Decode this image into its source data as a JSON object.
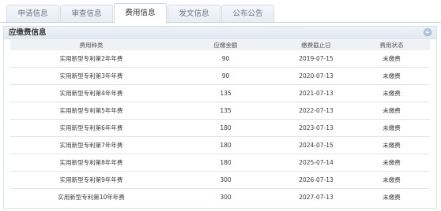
{
  "tabs": [
    {
      "label": "申请信息",
      "active": false
    },
    {
      "label": "审查信息",
      "active": false
    },
    {
      "label": "费用信息",
      "active": true
    },
    {
      "label": "发文信息",
      "active": false
    },
    {
      "label": "公布公告",
      "active": false
    }
  ],
  "panel": {
    "title": "应缴费信息",
    "collapse_icon": "circle-collapse-icon"
  },
  "table": {
    "headers": [
      "费用种类",
      "应缴金额",
      "缴费截止日",
      "费用状态"
    ],
    "rows": [
      {
        "fee_type": "实用新型专利第2年年费",
        "amount": "90",
        "deadline": "2019-07-15",
        "status": "未缴费"
      },
      {
        "fee_type": "实用新型专利第3年年费",
        "amount": "90",
        "deadline": "2020-07-13",
        "status": "未缴费"
      },
      {
        "fee_type": "实用新型专利第4年年费",
        "amount": "135",
        "deadline": "2021-07-13",
        "status": "未缴费"
      },
      {
        "fee_type": "实用新型专利第5年年费",
        "amount": "135",
        "deadline": "2022-07-13",
        "status": "未缴费"
      },
      {
        "fee_type": "实用新型专利第6年年费",
        "amount": "180",
        "deadline": "2023-07-13",
        "status": "未缴费"
      },
      {
        "fee_type": "实用新型专利第7年年费",
        "amount": "180",
        "deadline": "2024-07-15",
        "status": "未缴费"
      },
      {
        "fee_type": "实用新型专利第8年年费",
        "amount": "180",
        "deadline": "2025-07-14",
        "status": "未缴费"
      },
      {
        "fee_type": "实用新型专利第9年年费",
        "amount": "300",
        "deadline": "2026-07-13",
        "status": "未缴费"
      },
      {
        "fee_type": "实用新型专利第10年年费",
        "amount": "300",
        "deadline": "2027-07-13",
        "status": "未缴费"
      }
    ]
  }
}
